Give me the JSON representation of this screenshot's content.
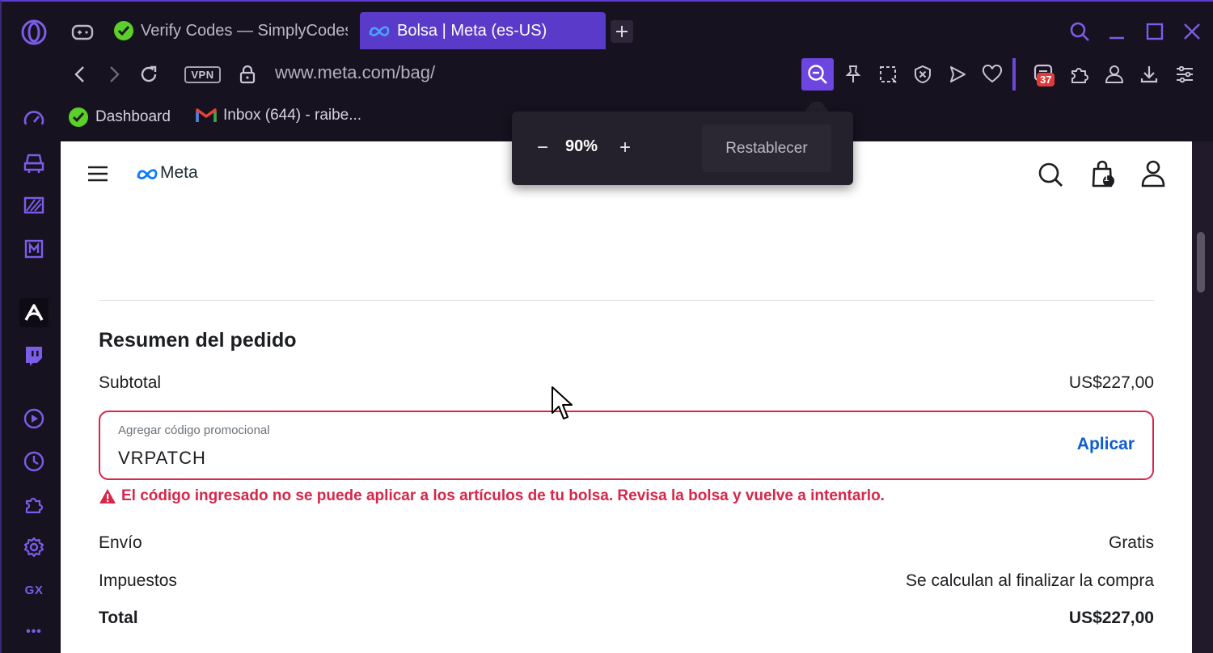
{
  "browser": {
    "tabs": [
      {
        "title": "Verify Codes — SimplyCodes",
        "active": false
      },
      {
        "title": "Bolsa | Meta (es-US)",
        "active": true
      }
    ],
    "vpn_label": "VPN",
    "url": "www.meta.com/bag/",
    "notification_count": "37",
    "bookmarks": [
      {
        "label": "Dashboard"
      },
      {
        "label": "Inbox (644) - raibe..."
      }
    ],
    "sidebar_gx_label": "GX",
    "sidebar_more": "•••",
    "accent_color": "#6d45e0"
  },
  "zoom_popup": {
    "minus": "−",
    "value": "90%",
    "plus": "+",
    "reset_label": "Restablecer"
  },
  "page": {
    "logo": "Meta",
    "cart_count": "1",
    "summary_title": "Resumen del pedido",
    "subtotal_label": "Subtotal",
    "subtotal_value": "US$227,00",
    "promo": {
      "label": "Agregar código promocional",
      "value": "VRPATCH",
      "apply_label": "Aplicar"
    },
    "error_message": "El código ingresado no se puede aplicar a los artículos de tu bolsa. Revisa la bolsa y vuelve a intentarlo.",
    "shipping_label": "Envío",
    "shipping_value": "Gratis",
    "taxes_label": "Impuestos",
    "taxes_value": "Se calculan al finalizar la compra",
    "total_label": "Total",
    "total_value": "US$227,00",
    "error_color": "#d7264a",
    "link_color": "#0b5cd5"
  }
}
